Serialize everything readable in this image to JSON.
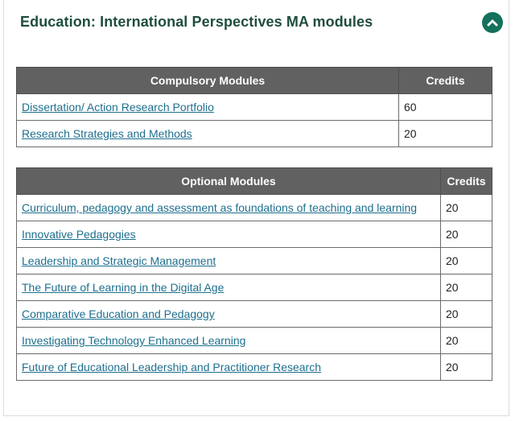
{
  "section": {
    "title": "Education: International Perspectives MA modules",
    "toggle_icon": "chevron-up-icon",
    "accent_color": "#13715c",
    "title_color": "#1f4d3f"
  },
  "compulsory": {
    "headers": [
      "Compulsory Modules",
      "Credits"
    ],
    "rows": [
      {
        "module": "Dissertation/ Action Research Portfolio",
        "credits": "60"
      },
      {
        "module": "Research Strategies and Methods",
        "credits": "20"
      }
    ]
  },
  "optional": {
    "headers": [
      "Optional Modules",
      "Credits"
    ],
    "rows": [
      {
        "module": "Curriculum, pedagogy and assessment as foundations of teaching and learning",
        "credits": "20"
      },
      {
        "module": "Innovative Pedagogies",
        "credits": "20"
      },
      {
        "module": "Leadership and Strategic Management",
        "credits": "20"
      },
      {
        "module": "The Future of Learning in the Digital Age",
        "credits": "20"
      },
      {
        "module": "Comparative Education and Pedagogy",
        "credits": "20"
      },
      {
        "module": "Investigating Technology Enhanced Learning",
        "credits": "20"
      },
      {
        "module": "Future of Educational Leadership and Practitioner Research",
        "credits": "20"
      }
    ]
  },
  "colors": {
    "header_bg": "#616161",
    "link": "#1d6f8e"
  }
}
